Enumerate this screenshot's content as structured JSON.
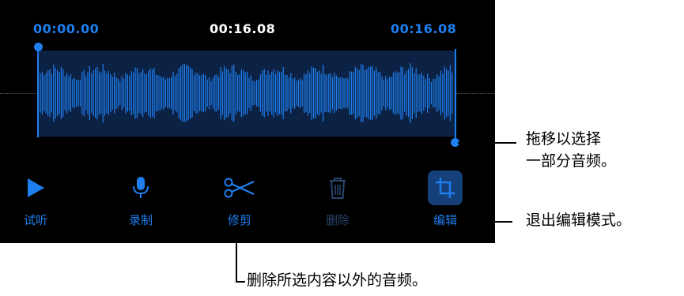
{
  "header": {
    "start_time": "00:00.00",
    "current_time": "00:16.08",
    "end_time": "00:16.08"
  },
  "toolbar": {
    "items": [
      {
        "label": "试听",
        "icon": "play-icon"
      },
      {
        "label": "录制",
        "icon": "microphone-icon"
      },
      {
        "label": "修剪",
        "icon": "scissors-icon"
      },
      {
        "label": "删除",
        "icon": "trash-icon"
      },
      {
        "label": "编辑",
        "icon": "crop-icon"
      }
    ]
  },
  "callouts": {
    "drag_line1": "拖移以选择",
    "drag_line2": "一部分音频。",
    "exit_edit": "退出编辑模式。",
    "trim": "删除所选内容以外的音频。"
  },
  "colors": {
    "accent": "#1e7ff0",
    "background": "#000000",
    "selection": "#0c2244",
    "disabled": "#29456d"
  }
}
